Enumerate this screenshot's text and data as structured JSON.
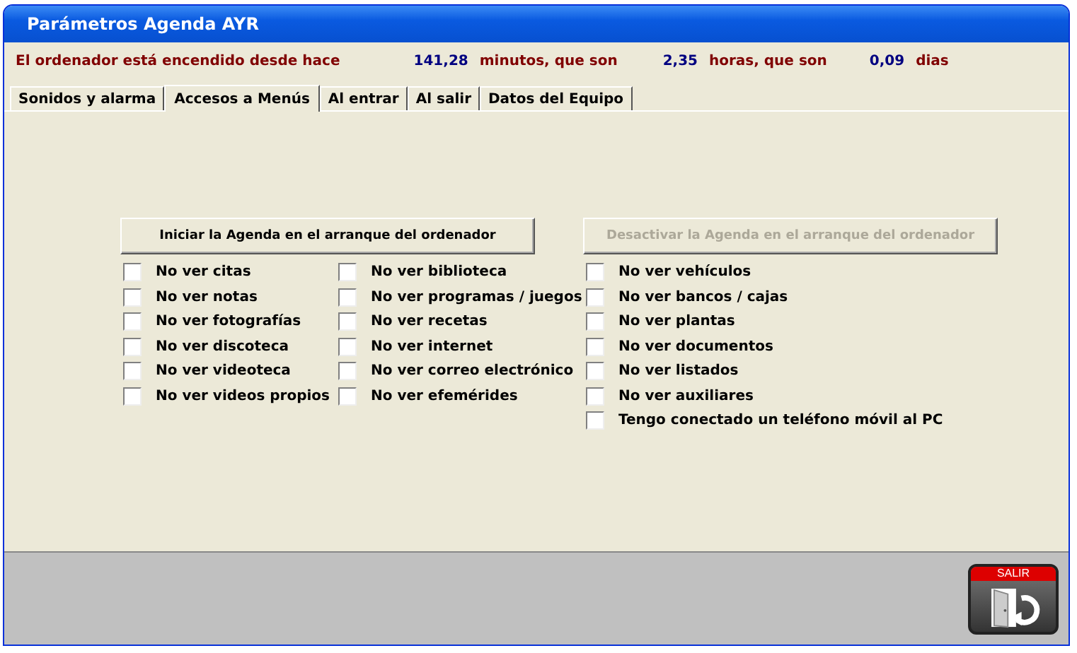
{
  "window": {
    "title": "Parámetros Agenda AYR"
  },
  "uptime": [
    {
      "kind": "label",
      "text": "El ordenador está encendido desde hace"
    },
    {
      "kind": "value",
      "text": "141,28"
    },
    {
      "kind": "label",
      "text": "minutos, que son"
    },
    {
      "kind": "value",
      "text": "2,35"
    },
    {
      "kind": "label",
      "text": "horas, que son"
    },
    {
      "kind": "value",
      "text": "0,09"
    },
    {
      "kind": "label",
      "text": "dias"
    }
  ],
  "tabs": [
    {
      "label": "Sonidos y alarma",
      "selected": false
    },
    {
      "label": "Accesos a Menús",
      "selected": true
    },
    {
      "label": "Al entrar",
      "selected": false
    },
    {
      "label": "Al salir",
      "selected": false
    },
    {
      "label": "Datos del Equipo",
      "selected": false
    }
  ],
  "groups": [
    {
      "button": {
        "label": "Iniciar la Agenda en el arranque del ordenador",
        "disabled": false
      },
      "columns": [
        [
          {
            "label": "No ver citas",
            "checked": false
          },
          {
            "label": "No ver notas",
            "checked": false
          },
          {
            "label": "No ver fotografías",
            "checked": false
          },
          {
            "label": "No ver discoteca",
            "checked": false
          },
          {
            "label": "No ver videoteca",
            "checked": false
          },
          {
            "label": "No ver videos propios",
            "checked": false
          }
        ],
        [
          {
            "label": "No ver biblioteca",
            "checked": false
          },
          {
            "label": "No ver programas / juegos",
            "checked": false
          },
          {
            "label": "No ver recetas",
            "checked": false
          },
          {
            "label": "No ver internet",
            "checked": false
          },
          {
            "label": "No ver correo electrónico",
            "checked": false
          },
          {
            "label": "No ver efemérides",
            "checked": false
          }
        ]
      ]
    },
    {
      "button": {
        "label": "Desactivar la Agenda en el arranque del ordenador",
        "disabled": true
      },
      "columns": [
        [
          {
            "label": "No ver vehículos",
            "checked": false
          },
          {
            "label": "No ver bancos / cajas",
            "checked": false
          },
          {
            "label": "No ver plantas",
            "checked": false
          },
          {
            "label": "No ver documentos",
            "checked": false
          },
          {
            "label": "No ver listados",
            "checked": false
          },
          {
            "label": "No ver auxiliares",
            "checked": false
          },
          {
            "label": "Tengo conectado un teléfono móvil al PC",
            "checked": false
          }
        ]
      ]
    }
  ],
  "exit_button": {
    "label": "SALIR"
  }
}
